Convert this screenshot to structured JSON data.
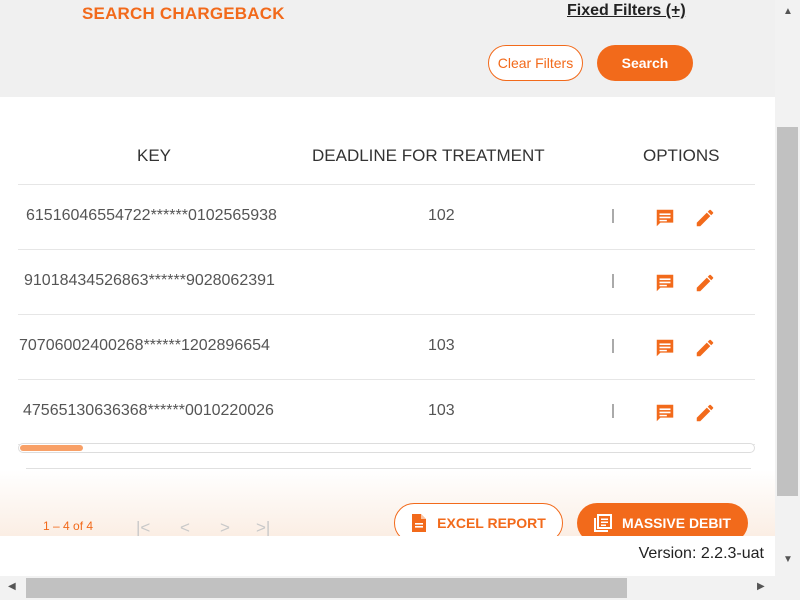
{
  "header": {
    "title": "SEARCH CHARGEBACK",
    "fixed_filters": "Fixed Filters (+)",
    "clear_filters": "Clear Filters",
    "search": "Search"
  },
  "table": {
    "columns": [
      "KEY",
      "DEADLINE FOR TREATMENT",
      "OPTIONS"
    ],
    "rows": [
      {
        "key": "61516046554722******0102565938",
        "deadline": "102"
      },
      {
        "key": "91018434526863******9028062391",
        "deadline": ""
      },
      {
        "key": "70706002400268******1202896654",
        "deadline": "103"
      },
      {
        "key": "47565130636368******0010220026",
        "deadline": "103"
      }
    ],
    "row_icons": [
      "comment-icon",
      "edit-pencil-icon"
    ],
    "horizontal_scroll_position": 0.09
  },
  "footer": {
    "range": "1 – 4 of 4",
    "pager": {
      "first": "|<",
      "prev": "<",
      "next": ">",
      "last": ">|"
    },
    "excel_report": "EXCEL REPORT",
    "massive_debit": "MASSIVE DEBIT",
    "version": "Version: 2.2.3-uat"
  },
  "colors": {
    "accent": "#f26a1b",
    "accent_light": "#f8a067",
    "panel": "#f0f0f0"
  }
}
